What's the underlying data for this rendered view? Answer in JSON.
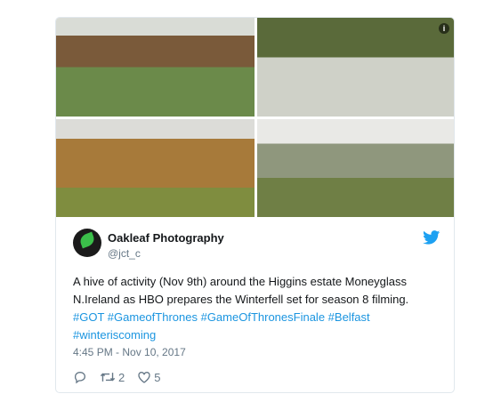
{
  "tweet": {
    "author_name": "Oakleaf Photography",
    "author_handle": "@jct_c",
    "text_plain": "A hive of activity (Nov 9th) around the Higgins estate Moneyglass N.Ireland as HBO prepares the Winterfell set for season 8 filming.",
    "hashtags": [
      "#GOT",
      "#GameofThrones",
      "#GameOfThronesFinale",
      "#Belfast",
      "#winteriscoming"
    ],
    "timestamp": "4:45 PM - Nov 10, 2017",
    "retweets": "2",
    "likes": "5",
    "info_glyph": "i"
  },
  "icons": {
    "brand": "twitter-bird-icon",
    "reply": "reply-icon",
    "retweet": "retweet-icon",
    "like": "heart-icon",
    "info": "info-icon"
  },
  "colors": {
    "link": "#1b95e0",
    "text": "#14171a",
    "muted": "#657786",
    "twitter_blue": "#1da1f2"
  }
}
